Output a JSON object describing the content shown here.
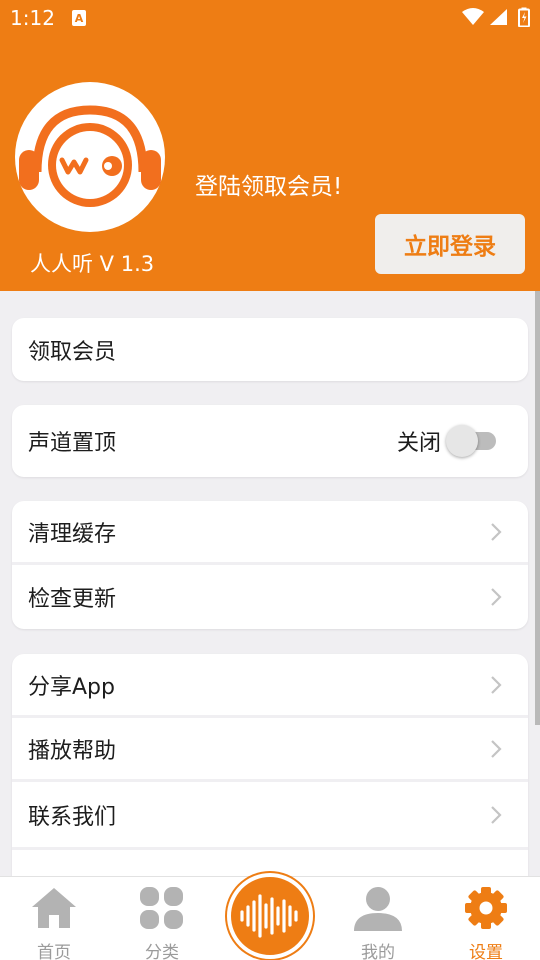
{
  "status_bar": {
    "time": "1:12"
  },
  "header": {
    "app_version": "人人听 V 1.3",
    "login_prompt": "登陆领取会员!",
    "login_button_label": "立即登录"
  },
  "settings": {
    "get_membership": "领取会员",
    "channel_pin": {
      "label": "声道置顶",
      "state_label": "关闭",
      "enabled": false
    },
    "clear_cache": "清理缓存",
    "check_update": "检查更新",
    "share_app": "分享App",
    "playback_help": "播放帮助",
    "contact_us": "联系我们"
  },
  "bottom_nav": {
    "home": "首页",
    "category": "分类",
    "mine": "我的",
    "settings": "设置",
    "active": "settings"
  },
  "colors": {
    "accent": "#ee7d14",
    "background": "#f0eff2",
    "inactive": "#9b9b9b"
  }
}
